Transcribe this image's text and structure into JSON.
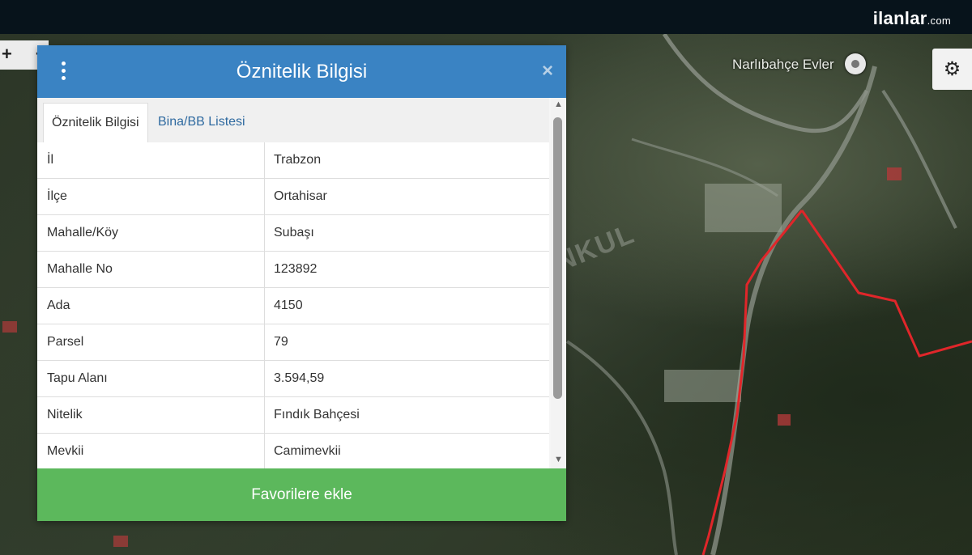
{
  "brand": {
    "name": "ilanlar",
    "suffix": ".com"
  },
  "map": {
    "poi_label": "Narlıbahçe Evler",
    "watermark": "ENKUL",
    "zoom_in": "+",
    "zoom_out": "-",
    "settings_icon": "gear-icon",
    "parcel_color": "#e0262a"
  },
  "modal": {
    "title": "Öznitelik Bilgisi",
    "close": "×",
    "tabs": [
      {
        "label": "Öznitelik Bilgisi"
      },
      {
        "label": "Bina/BB Listesi"
      }
    ],
    "rows": [
      {
        "key": "İl",
        "value": "Trabzon"
      },
      {
        "key": "İlçe",
        "value": "Ortahisar"
      },
      {
        "key": "Mahalle/Köy",
        "value": "Subaşı"
      },
      {
        "key": "Mahalle No",
        "value": "123892"
      },
      {
        "key": "Ada",
        "value": "4150"
      },
      {
        "key": "Parsel",
        "value": "79"
      },
      {
        "key": "Tapu Alanı",
        "value": "3.594,59"
      },
      {
        "key": "Nitelik",
        "value": "Fındık Bahçesi"
      },
      {
        "key": "Mevkii",
        "value": "Camimevkii"
      }
    ],
    "footer_button": "Favorilere ekle"
  },
  "colors": {
    "header": "#3a83c3",
    "button": "#5cb85c",
    "tab_link": "#2f6aa0"
  }
}
